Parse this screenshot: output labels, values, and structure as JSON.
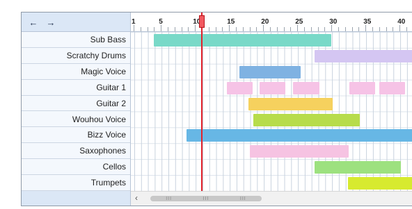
{
  "navigation": {
    "back_icon": "arrow-left-icon",
    "forward_icon": "arrow-right-icon",
    "back_label": "←",
    "forward_label": "→"
  },
  "ruler": {
    "ticks": [
      "1",
      "5",
      "10",
      "15",
      "20",
      "25",
      "30",
      "35",
      "40"
    ],
    "tick_values": [
      1,
      5,
      10,
      15,
      20,
      25,
      30,
      35,
      40
    ]
  },
  "tracks": [
    {
      "name": "Sub Bass",
      "clips": [
        {
          "start": 4,
          "end": 30,
          "color": "#79d9c8"
        }
      ]
    },
    {
      "name": "Scratchy Drums",
      "clips": [
        {
          "start": 27.5,
          "end": 42,
          "color": "#d4c6f2"
        }
      ]
    },
    {
      "name": "Magic Voice",
      "clips": [
        {
          "start": 16.5,
          "end": 25.5,
          "color": "#7fb2e2"
        }
      ]
    },
    {
      "name": "Guitar 1",
      "clips": [
        {
          "start": 14.7,
          "end": 18.5,
          "color": "#f6c3e6"
        },
        {
          "start": 19.5,
          "end": 23.2,
          "color": "#f6c3e6"
        },
        {
          "start": 24.4,
          "end": 28.2,
          "color": "#f6c3e6"
        },
        {
          "start": 32.6,
          "end": 36.4,
          "color": "#f6c3e6"
        },
        {
          "start": 37.0,
          "end": 40.8,
          "color": "#f6c3e6"
        }
      ]
    },
    {
      "name": "Guitar 2",
      "clips": [
        {
          "start": 17.8,
          "end": 30.2,
          "color": "#f6d15e"
        }
      ]
    },
    {
      "name": "Wouhou Voice",
      "clips": [
        {
          "start": 18.5,
          "end": 34.2,
          "color": "#b7dc4b"
        }
      ]
    },
    {
      "name": "Bizz Voice",
      "clips": [
        {
          "start": 8.8,
          "end": 42,
          "color": "#67b7e5"
        }
      ]
    },
    {
      "name": "Saxophones",
      "clips": [
        {
          "start": 18.0,
          "end": 32.5,
          "color": "#f6c3e2"
        }
      ]
    },
    {
      "name": "Cellos",
      "clips": [
        {
          "start": 27.5,
          "end": 40.2,
          "color": "#9de17f"
        }
      ]
    },
    {
      "name": "Trumpets",
      "clips": [
        {
          "start": 32.4,
          "end": 42,
          "color": "#d7ea2f"
        }
      ]
    }
  ],
  "playhead": {
    "position": 10.9,
    "color": "#e2222b"
  },
  "scrollbar": {
    "left_arrow_label": "‹",
    "thumb_grip_label": "III"
  }
}
